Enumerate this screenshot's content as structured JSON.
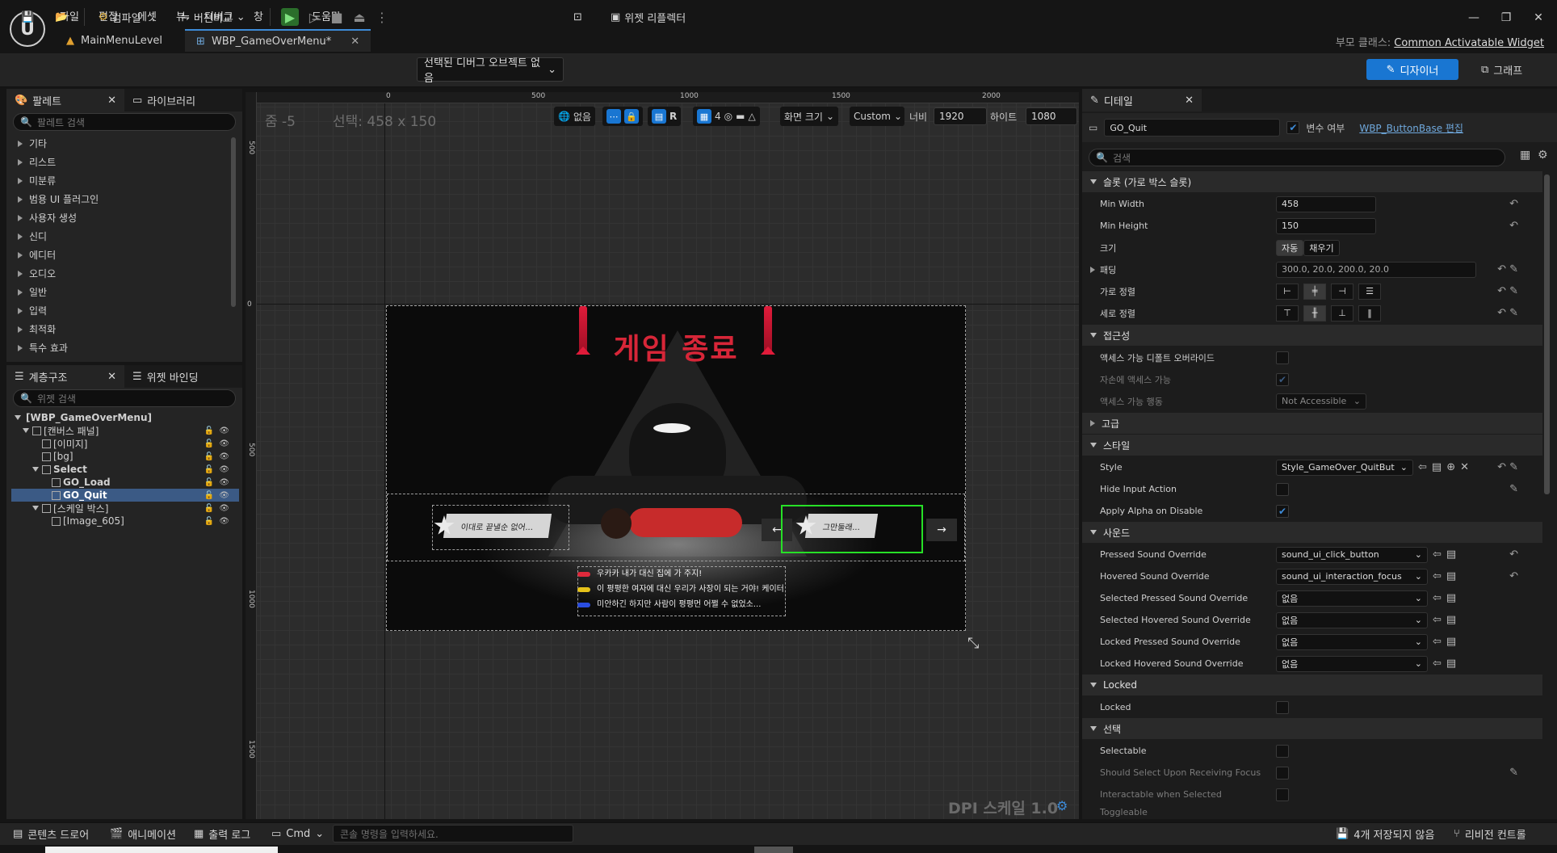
{
  "menu": [
    "파일",
    "편집",
    "에셋",
    "뷰",
    "디버그",
    "창",
    "툴",
    "도움말"
  ],
  "tabs": [
    {
      "label": "MainMenuLevel",
      "active": false
    },
    {
      "label": "WBP_GameOverMenu*",
      "active": true
    }
  ],
  "parent_class": {
    "label": "부모 클래스:",
    "value": "Common Activatable Widget"
  },
  "toolbar": {
    "compile": "컴파일",
    "diff": "버전비교",
    "debug_object": "선택된 디버그 오브젝트 없음",
    "widget_reflector": "위젯 리플렉터",
    "designer": "디자이너",
    "graph": "그래프"
  },
  "palette": {
    "tab": "팔레트",
    "library_tab": "라이브러리",
    "search_placeholder": "팔레트 검색",
    "categories": [
      "기타",
      "리스트",
      "미분류",
      "범용 UI 플러그인",
      "사용자 생성",
      "신디",
      "에디터",
      "오디오",
      "일반",
      "입력",
      "최적화",
      "특수 효과"
    ]
  },
  "hierarchy": {
    "tab": "계층구조",
    "bind_tab": "위젯 바인딩",
    "search_placeholder": "위젯 검색",
    "items": [
      {
        "label": "[WBP_GameOverMenu]",
        "level": 0,
        "bold": true
      },
      {
        "label": "[캔버스 패널]",
        "level": 1
      },
      {
        "label": "[이미지]",
        "level": 2
      },
      {
        "label": "[bg]",
        "level": 2
      },
      {
        "label": "Select",
        "level": 2,
        "bold": true
      },
      {
        "label": "GO_Load",
        "level": 3,
        "bold": true
      },
      {
        "label": "GO_Quit",
        "level": 3,
        "bold": true,
        "selected": true
      },
      {
        "label": "[스케일 박스]",
        "level": 2
      },
      {
        "label": "[Image_605]",
        "level": 3
      }
    ]
  },
  "canvas": {
    "zoom": "줌 -5",
    "selection": "선택: 458 x 150",
    "none_label": "없음",
    "grid_value": "4",
    "r_label": "R",
    "screen_size": "화면 크기",
    "preset": "Custom",
    "width_label": "너비",
    "width": "1920",
    "height_label": "하이트",
    "height": "1080",
    "dpi": "DPI 스케일 1.0",
    "ruler_top": [
      "0",
      "500",
      "1000",
      "1500",
      "2000"
    ],
    "ruler_left": [
      "500",
      "0",
      "500",
      "1000",
      "1500"
    ]
  },
  "preview": {
    "title": "게임 종료",
    "left_button": "이대로 끝낼순 없어...",
    "right_button": "그만둘래...",
    "prev": "←",
    "next": "→",
    "dialog": [
      {
        "text": "우카카 내가 대신 집에 가 주지!",
        "color": "#e02a3c"
      },
      {
        "text": "이 평평한 여자에 대신 우리가 사장이 되는 거야! 케이터",
        "color": "#e6c21a"
      },
      {
        "text": "미안하긴 하지만 사람이 평평먼 어쩔 수 없었소...",
        "color": "#2a4de0"
      }
    ]
  },
  "details": {
    "tab": "디테일",
    "name": "GO_Quit",
    "is_variable": "변수 여부",
    "edit_link": "WBP_ButtonBase 편집",
    "search_placeholder": "검색",
    "sections": {
      "slot": "슬롯 (가로 박스 슬롯)",
      "accessibility": "접근성",
      "advanced": "고급",
      "style": "스타일",
      "sound": "사운드",
      "locked": "Locked",
      "selection": "선택"
    },
    "min_width_label": "Min Width",
    "min_width": "458",
    "min_height_label": "Min Height",
    "min_height": "150",
    "size_label": "크기",
    "size_auto": "자동",
    "size_fill": "채우기",
    "padding_label": "패딩",
    "padding": "300.0, 20.0, 200.0, 20.0",
    "halign_label": "가로 정렬",
    "valign_label": "세로 정렬",
    "acc_override": "액세스 가능 디폴트 오버라이드",
    "acc_children": "자손에 액세스 가능",
    "acc_behavior": "액세스 가능 행동",
    "acc_behavior_value": "Not Accessible",
    "style_label": "Style",
    "style_value": "Style_GameOver_QuitButton",
    "hide_input": "Hide Input Action",
    "apply_alpha": "Apply Alpha on Disable",
    "sounds": [
      {
        "label": "Pressed Sound Override",
        "value": "sound_ui_click_button"
      },
      {
        "label": "Hovered Sound Override",
        "value": "sound_ui_interaction_focus"
      },
      {
        "label": "Selected Pressed Sound Override",
        "value": "없음"
      },
      {
        "label": "Selected Hovered Sound Override",
        "value": "없음"
      },
      {
        "label": "Locked Pressed Sound Override",
        "value": "없음"
      },
      {
        "label": "Locked Hovered Sound Override",
        "value": "없음"
      }
    ],
    "locked_label": "Locked",
    "selectable": "Selectable",
    "select_on_focus": "Should Select Upon Receiving Focus",
    "interactable_selected": "Interactable when Selected",
    "toggleable": "Toggleable"
  },
  "bottom": {
    "content_drawer": "콘텐츠 드로어",
    "animation": "애니메이션",
    "output_log": "출력 로그",
    "cmd": "Cmd",
    "console_placeholder": "콘솔 명령을 입력하세요.",
    "unsaved": "4개 저장되지 않음",
    "revision": "리비전 컨트롤"
  }
}
